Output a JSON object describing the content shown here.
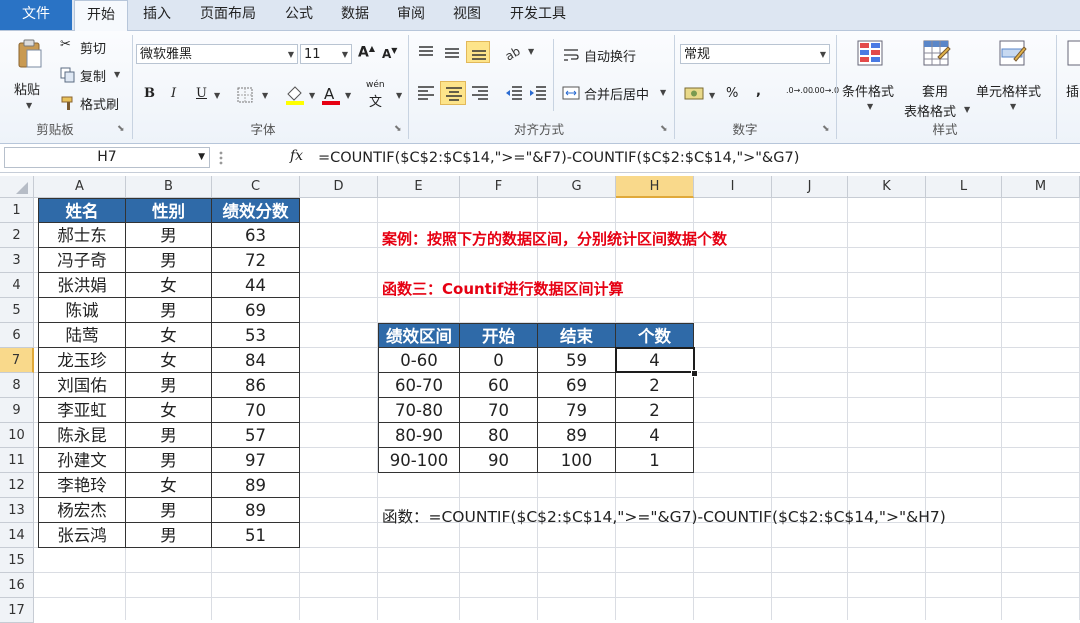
{
  "menu_tabs": [
    "文件",
    "开始",
    "插入",
    "页面布局",
    "公式",
    "数据",
    "审阅",
    "视图",
    "开发工具"
  ],
  "ribbon": {
    "clipboard": {
      "paste": "粘贴",
      "cut": "剪切",
      "copy": "复制",
      "format_painter": "格式刷",
      "label": "剪贴板"
    },
    "font": {
      "name": "微软雅黑",
      "size": "11",
      "bold": "B",
      "italic": "I",
      "underline": "U",
      "wen": "wén",
      "label": "字体"
    },
    "alignment": {
      "wrap_text": "自动换行",
      "merge_center": "合并后居中",
      "label": "对齐方式"
    },
    "number": {
      "format": "常规",
      "percent": "%",
      "comma": ",",
      "inc_decimal": ".0→.00",
      "dec_decimal": ".00→.0",
      "label": "数字"
    },
    "styles": {
      "conditional": "条件格式",
      "table_format_1": "套用",
      "table_format_2": "表格格式",
      "cell_styles": "单元格样式",
      "label": "样式"
    },
    "insert_partial": "插"
  },
  "formula_bar": {
    "name_box": "H7",
    "fx": "fx",
    "formula": "=COUNTIF($C$2:$C$14,\">=\"&F7)-COUNTIF($C$2:$C$14,\">\"&G7)"
  },
  "sheet": {
    "columns": [
      "A",
      "B",
      "C",
      "D",
      "E",
      "F",
      "G",
      "H",
      "I",
      "J",
      "K",
      "L",
      "M"
    ],
    "rows": [
      "1",
      "2",
      "3",
      "4",
      "5",
      "6",
      "7",
      "8",
      "9",
      "10",
      "11",
      "12",
      "13",
      "14",
      "15",
      "16",
      "17"
    ],
    "selected_column": "H",
    "selected_row": "7",
    "table1_headers": [
      "姓名",
      "性别",
      "绩效分数"
    ],
    "table1_rows": [
      [
        "郝士东",
        "男",
        "63"
      ],
      [
        "冯子奇",
        "男",
        "72"
      ],
      [
        "张洪娟",
        "女",
        "44"
      ],
      [
        "陈诚",
        "男",
        "69"
      ],
      [
        "陆莺",
        "女",
        "53"
      ],
      [
        "龙玉珍",
        "女",
        "84"
      ],
      [
        "刘国佑",
        "男",
        "86"
      ],
      [
        "李亚虹",
        "女",
        "70"
      ],
      [
        "陈永昆",
        "男",
        "57"
      ],
      [
        "孙建文",
        "男",
        "97"
      ],
      [
        "李艳玲",
        "女",
        "89"
      ],
      [
        "杨宏杰",
        "男",
        "89"
      ],
      [
        "张云鸿",
        "男",
        "51"
      ]
    ],
    "case_note": "案例：按照下方的数据区间，分别统计区间数据个数",
    "method_note": "函数三：Countif进行数据区间计算",
    "table2_headers": [
      "绩效区间",
      "开始",
      "结束",
      "个数"
    ],
    "table2_rows": [
      [
        "0-60",
        "0",
        "59",
        "4"
      ],
      [
        "60-70",
        "60",
        "69",
        "2"
      ],
      [
        "70-80",
        "70",
        "79",
        "2"
      ],
      [
        "80-90",
        "80",
        "89",
        "4"
      ],
      [
        "90-100",
        "90",
        "100",
        "1"
      ]
    ],
    "formula_note": "函数：=COUNTIF($C$2:$C$14,\">=\"&G7)-COUNTIF($C$2:$C$14,\">\"&H7)"
  },
  "colors": {
    "header_blue": "#2f6aa8",
    "note_red": "#e60012",
    "file_tab": "#2a73c5",
    "selection": "#f9d98b"
  }
}
